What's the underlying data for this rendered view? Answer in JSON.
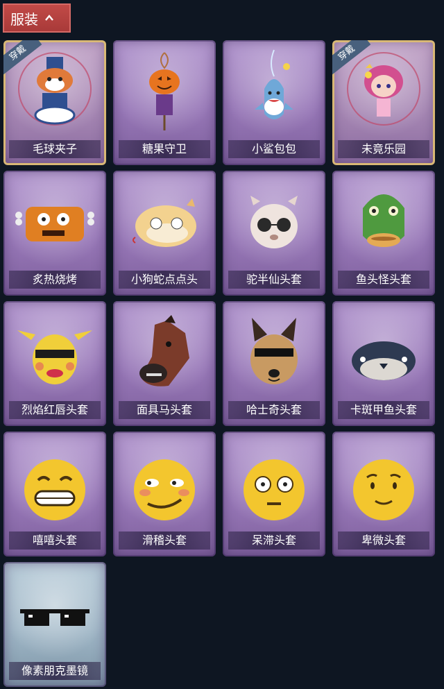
{
  "section": {
    "title": "服装",
    "expanded": true
  },
  "equipped_tag": "穿戴",
  "items": [
    {
      "name": "毛球夹子",
      "equipped": true,
      "icon": "raccoon-drummer-icon"
    },
    {
      "name": "糖果守卫",
      "equipped": false,
      "icon": "pumpkin-scarecrow-icon"
    },
    {
      "name": "小鲨包包",
      "equipped": false,
      "icon": "shark-bag-icon"
    },
    {
      "name": "未竟乐园",
      "equipped": true,
      "icon": "pink-doll-icon"
    },
    {
      "name": "炙热烧烤",
      "equipped": false,
      "icon": "bbq-head-icon"
    },
    {
      "name": "小狗蛇点点头",
      "equipped": false,
      "icon": "dog-snake-head-icon"
    },
    {
      "name": "驼半仙头套",
      "equipped": false,
      "icon": "alpaca-head-icon"
    },
    {
      "name": "鱼头怪头套",
      "equipped": false,
      "icon": "fish-head-icon"
    },
    {
      "name": "烈焰红唇头套",
      "equipped": false,
      "icon": "yellow-lips-head-icon"
    },
    {
      "name": "面具马头套",
      "equipped": false,
      "icon": "horse-head-icon"
    },
    {
      "name": "哈士奇头套",
      "equipped": false,
      "icon": "husky-head-icon"
    },
    {
      "name": "卡斑甲鱼头套",
      "equipped": false,
      "icon": "turtle-head-icon"
    },
    {
      "name": "嘻嘻头套",
      "equipped": false,
      "icon": "grin-emoji-head-icon"
    },
    {
      "name": "滑稽头套",
      "equipped": false,
      "icon": "smirk-emoji-head-icon"
    },
    {
      "name": "呆滞头套",
      "equipped": false,
      "icon": "dazed-emoji-head-icon"
    },
    {
      "name": "卑微头套",
      "equipped": false,
      "icon": "humble-emoji-head-icon"
    },
    {
      "name": "像素朋克墨镜",
      "equipped": false,
      "icon": "pixel-sunglasses-icon",
      "rarity": "blue"
    }
  ]
}
